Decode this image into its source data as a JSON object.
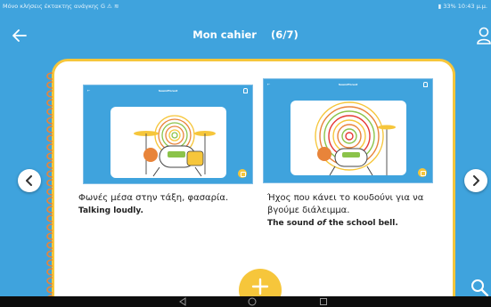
{
  "statusbar": {
    "left_text": "Μόνο κλήσεις έκτακτης ανάγκης",
    "left_icons": "G ⚠ ≋",
    "right_text": "33%",
    "time": "10:43 μ.μ."
  },
  "header": {
    "title": "Mon cahier",
    "page_indicator": "(6/7)"
  },
  "entries": [
    {
      "image_title": "SoundForest",
      "caption_greek": "Φωνές μέσα στην τάξη, φασαρία.",
      "caption_english": "Talking loudly",
      "caption_english_suffix": "."
    },
    {
      "image_title": "SoundForest",
      "caption_greek": "Ήχος που κάνει το κουδούνι για να βγούμε διάλειμμα.",
      "caption_english_part1": "The sound ",
      "caption_english_em": "of",
      "caption_english_part2": " the school bell",
      "caption_english_suffix": "."
    }
  ],
  "icons": {
    "back": "arrow-left",
    "user": "user-outline",
    "prev": "chevron-left",
    "next": "chevron-right",
    "add": "plus",
    "search": "magnifier"
  },
  "colors": {
    "background": "#3fa3dd",
    "accent": "#f6c63b",
    "ring": "#e8843a"
  }
}
